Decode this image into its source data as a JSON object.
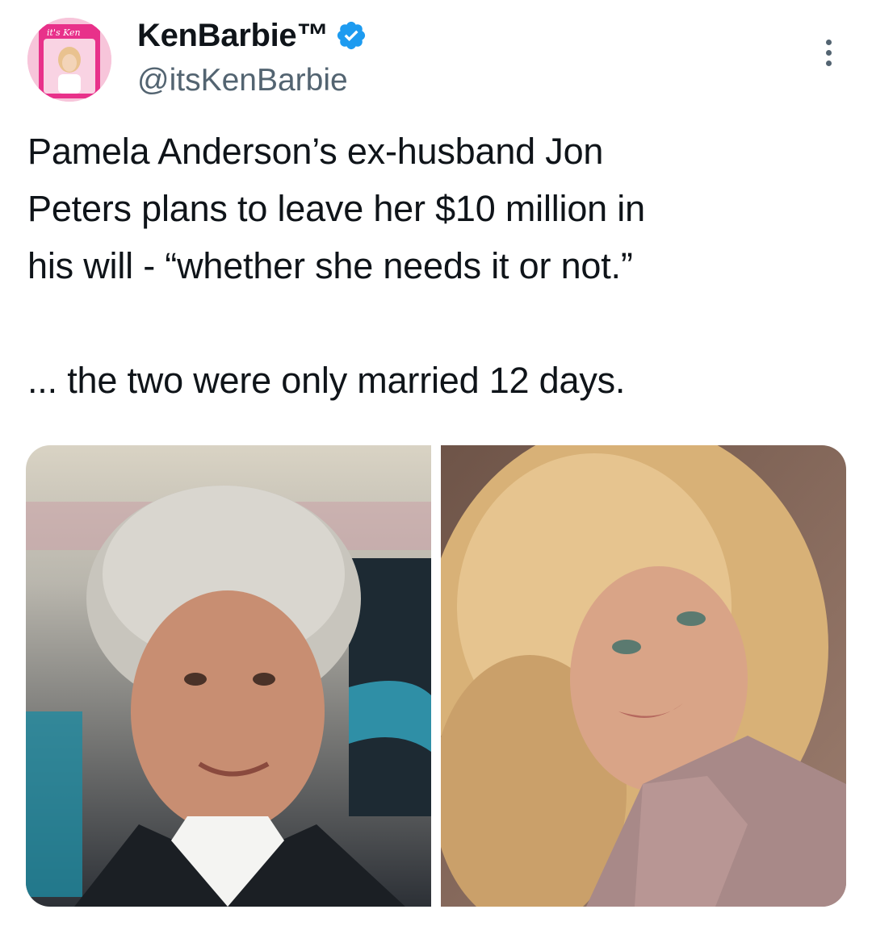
{
  "account": {
    "display_name": "KenBarbie™",
    "handle": "@itsKenBarbie",
    "verified": true,
    "verified_color": "#1d9bf0",
    "avatar_icon": "barbie-box-avatar",
    "avatar_logo_text": "it's Ken"
  },
  "more_icon": "more-vertical-icon",
  "tweet": {
    "text_paragraph_1": "Pamela Anderson’s ex-husband Jon\nPeters plans to leave her $10 million in\nhis will - “whether she needs it or not.”",
    "text_paragraph_2": "... the two were only married 12 days."
  },
  "media": [
    {
      "icon": "photo-man-gray-hair",
      "description_color": "#8a8a7a"
    },
    {
      "icon": "photo-woman-blonde-hair",
      "description_color": "#c9a06a"
    }
  ],
  "colors": {
    "text_primary": "#0f1419",
    "text_secondary": "#536471",
    "avatar_pink": "#e8318a"
  }
}
